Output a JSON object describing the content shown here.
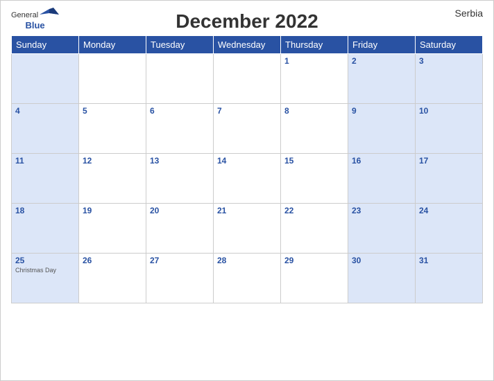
{
  "header": {
    "title": "December 2022",
    "country": "Serbia",
    "logo_general": "General",
    "logo_blue": "Blue"
  },
  "days_of_week": [
    "Sunday",
    "Monday",
    "Tuesday",
    "Wednesday",
    "Thursday",
    "Friday",
    "Saturday"
  ],
  "weeks": [
    [
      {
        "date": "",
        "type": "weekend"
      },
      {
        "date": "",
        "type": "weekday"
      },
      {
        "date": "",
        "type": "weekday"
      },
      {
        "date": "",
        "type": "weekday"
      },
      {
        "date": "1",
        "type": "weekday"
      },
      {
        "date": "2",
        "type": "weekend"
      },
      {
        "date": "3",
        "type": "weekend"
      }
    ],
    [
      {
        "date": "4",
        "type": "weekend"
      },
      {
        "date": "5",
        "type": "weekday"
      },
      {
        "date": "6",
        "type": "weekday"
      },
      {
        "date": "7",
        "type": "weekday"
      },
      {
        "date": "8",
        "type": "weekday"
      },
      {
        "date": "9",
        "type": "weekend"
      },
      {
        "date": "10",
        "type": "weekend"
      }
    ],
    [
      {
        "date": "11",
        "type": "weekend"
      },
      {
        "date": "12",
        "type": "weekday"
      },
      {
        "date": "13",
        "type": "weekday"
      },
      {
        "date": "14",
        "type": "weekday"
      },
      {
        "date": "15",
        "type": "weekday"
      },
      {
        "date": "16",
        "type": "weekend"
      },
      {
        "date": "17",
        "type": "weekend"
      }
    ],
    [
      {
        "date": "18",
        "type": "weekend"
      },
      {
        "date": "19",
        "type": "weekday"
      },
      {
        "date": "20",
        "type": "weekday"
      },
      {
        "date": "21",
        "type": "weekday"
      },
      {
        "date": "22",
        "type": "weekday"
      },
      {
        "date": "23",
        "type": "weekend"
      },
      {
        "date": "24",
        "type": "weekend"
      }
    ],
    [
      {
        "date": "25",
        "type": "weekend",
        "event": "Christmas Day"
      },
      {
        "date": "26",
        "type": "weekday"
      },
      {
        "date": "27",
        "type": "weekday"
      },
      {
        "date": "28",
        "type": "weekday"
      },
      {
        "date": "29",
        "type": "weekday"
      },
      {
        "date": "30",
        "type": "weekend"
      },
      {
        "date": "31",
        "type": "weekend"
      }
    ]
  ]
}
